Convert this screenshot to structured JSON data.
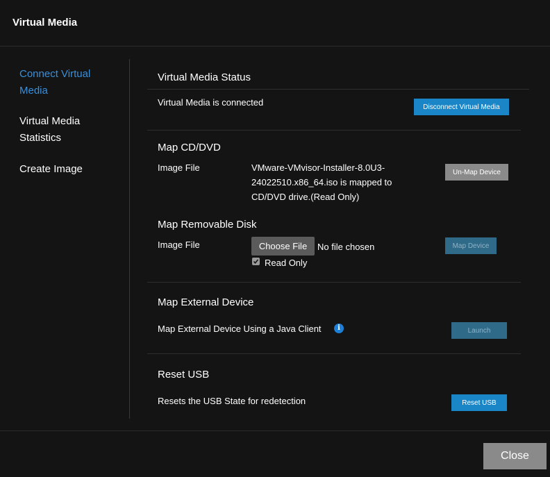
{
  "header": {
    "title": "Virtual Media"
  },
  "sidebar": {
    "items": [
      {
        "label_line1": "Connect Virtual",
        "label_line2": "Media"
      },
      {
        "label_line1": "Virtual Media",
        "label_line2": "Statistics"
      },
      {
        "label_line1": "Create Image"
      }
    ]
  },
  "status": {
    "title": "Virtual Media Status",
    "text": "Virtual Media is connected",
    "disconnect_label": "Disconnect Virtual Media"
  },
  "cd_dvd": {
    "title": "Map CD/DVD",
    "field_label": "Image File",
    "value_line1": "VMware-VMvisor-Installer-8.0U3-",
    "value_line2": "24022510.x86_64.iso is mapped to",
    "value_line3": "CD/DVD drive.(Read Only)",
    "unmap_label": "Un-Map Device"
  },
  "removable": {
    "title": "Map Removable Disk",
    "field_label": "Image File",
    "choose_label": "Choose File",
    "file_status": "No file chosen",
    "read_only_label": "Read Only",
    "read_only_checked": true,
    "map_label": "Map Device"
  },
  "external": {
    "title": "Map External Device",
    "text": "Map External Device Using a Java Client",
    "info_icon": "info-icon",
    "launch_label": "Launch"
  },
  "reset": {
    "title": "Reset USB",
    "text": "Resets the USB State for redetection",
    "reset_label": "Reset USB"
  },
  "footer": {
    "close_label": "Close"
  },
  "colors": {
    "background": "#141414",
    "accent_blue": "#1a86c8",
    "active_nav": "#3a8fd9",
    "gray_button": "#8a8a8a"
  }
}
